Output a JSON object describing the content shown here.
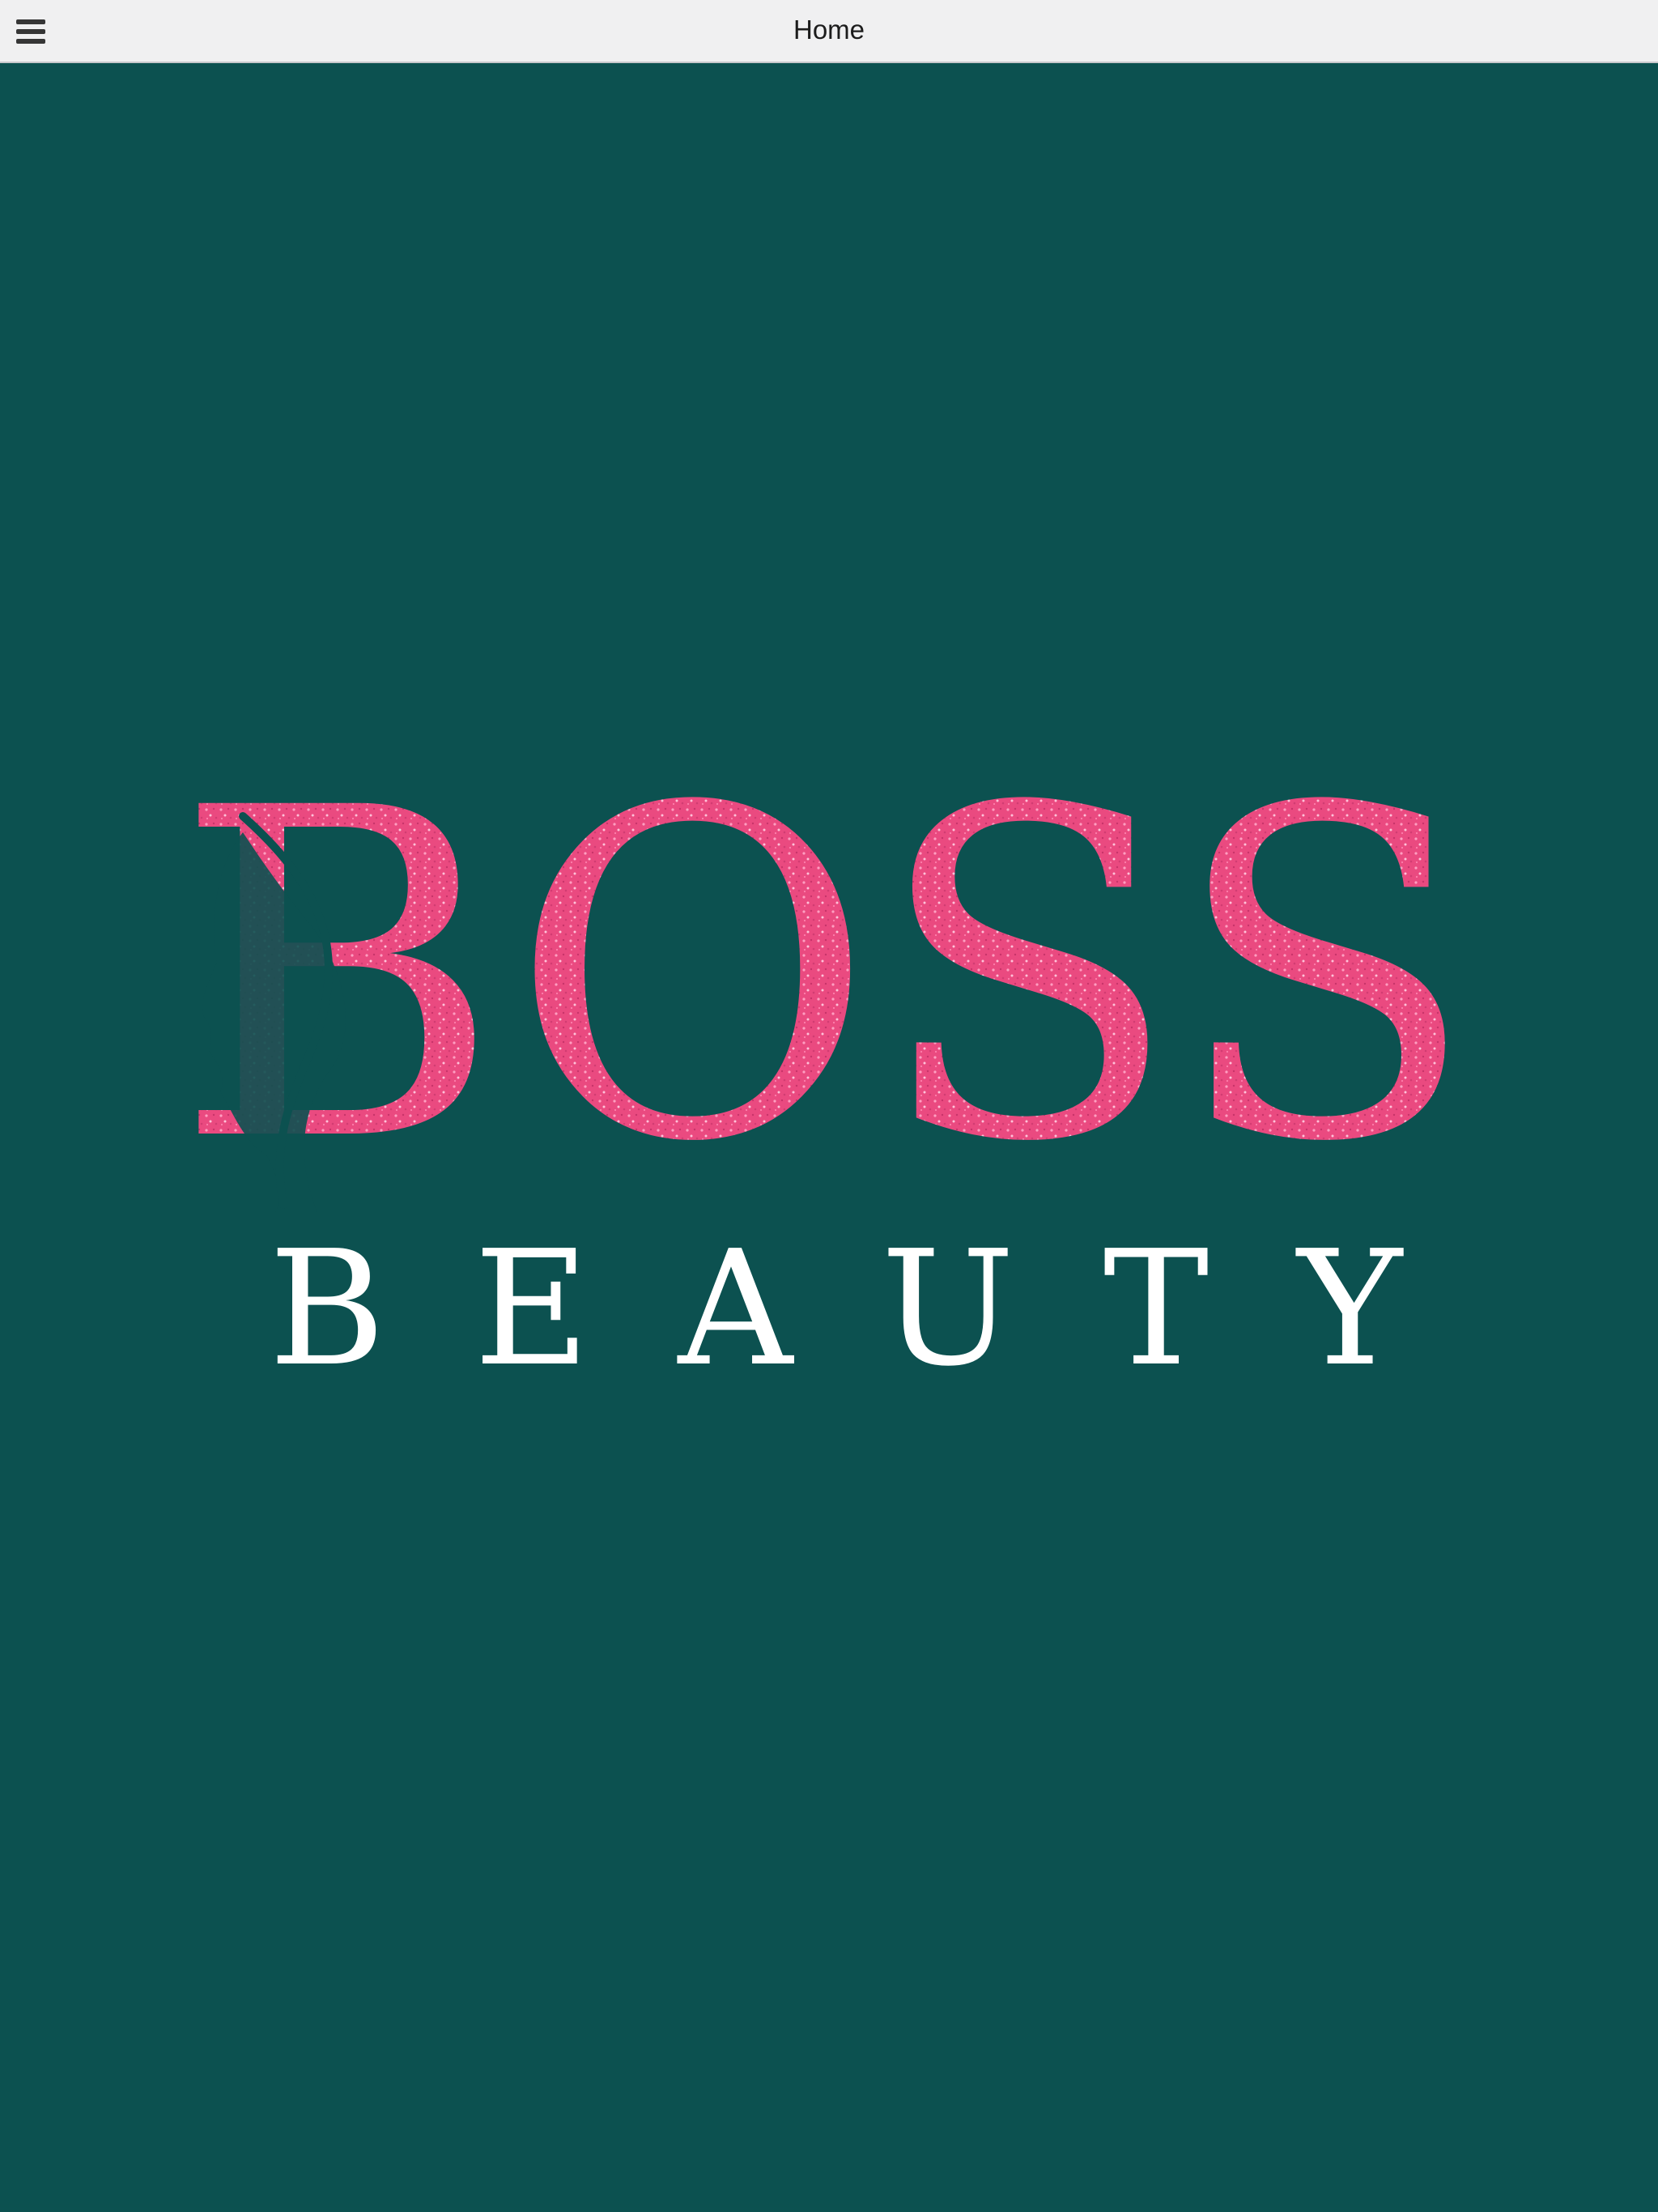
{
  "navbar": {
    "title": "Home",
    "menu_icon": "hamburger-menu-icon",
    "background": "#f0f0f1"
  },
  "main": {
    "background": "#0c5150",
    "logo": {
      "wordmark": "BOSS",
      "tagline": "BEAUTY",
      "wordmark_color": "#ec4a82",
      "tagline_color": "#ffffff"
    }
  }
}
